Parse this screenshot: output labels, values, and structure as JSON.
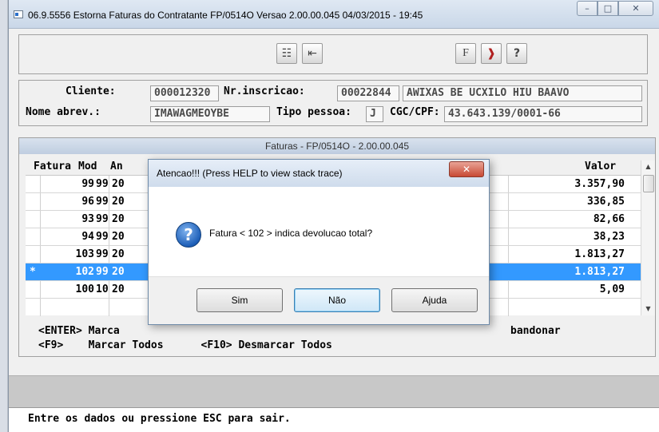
{
  "window": {
    "title": "06.9.5556  Estorna Faturas do Contratante FP/0514O Versao 2.00.00.045 04/03/2015 - 19:45",
    "buttons": {
      "minimize": "–",
      "maximize": "□",
      "close": "✕"
    }
  },
  "toolbar": {
    "icons": [
      "grid-star-icon",
      "exit-list-icon",
      "f-key-icon",
      "door-exit-icon",
      "help-question-icon"
    ],
    "glyphs": {
      "grid": "☷",
      "list": "⇤",
      "fkey": "F",
      "door": "❱",
      "help": "?"
    }
  },
  "client": {
    "cliente_label": "Cliente:",
    "cliente_value": "000012320",
    "inscricao_label": "Nr.inscricao:",
    "inscricao_value": "00022844",
    "name_value": "AWIXAS BE UCXILO HIU BAAVO",
    "nome_abrev_label": "Nome abrev.:",
    "nome_abrev_value": "IMAWAGMEOYBE",
    "tipo_pessoa_label": "Tipo pessoa:",
    "tipo_pessoa_value": "J",
    "cgc_label": "CGC/CPF:",
    "cgc_value": "43.643.139/0001-66"
  },
  "faturas": {
    "panel_title": "Faturas - FP/0514O - 2.00.00.045",
    "columns": {
      "fatura": "Fatura",
      "mod": "Mod",
      "an": "An",
      "valor": "Valor"
    },
    "rows": [
      {
        "mark": "",
        "fatura": "99",
        "mod": "99",
        "ano": "20",
        "valor": "3.357,90",
        "selected": false
      },
      {
        "mark": "",
        "fatura": "96",
        "mod": "99",
        "ano": "20",
        "valor": "336,85",
        "selected": false
      },
      {
        "mark": "",
        "fatura": "93",
        "mod": "99",
        "ano": "20",
        "valor": "82,66",
        "selected": false
      },
      {
        "mark": "",
        "fatura": "94",
        "mod": "99",
        "ano": "20",
        "valor": "38,23",
        "selected": false
      },
      {
        "mark": "",
        "fatura": "103",
        "mod": "99",
        "ano": "20",
        "valor": "1.813,27",
        "selected": false
      },
      {
        "mark": "*",
        "fatura": "102",
        "mod": "99",
        "ano": "20",
        "valor": "1.813,27",
        "selected": true
      },
      {
        "mark": "",
        "fatura": "100",
        "mod": "10",
        "ano": "20",
        "valor": "5,09",
        "selected": false
      }
    ],
    "help_line1_left": "<ENTER> Marca",
    "help_line1_right": "bandonar",
    "help_line2": "<F9>    Marcar Todos      <F10> Desmarcar Todos"
  },
  "status": {
    "message": "Entre os dados ou pressione ESC para sair."
  },
  "dialog": {
    "title": "Atencao!!! (Press HELP to view stack trace)",
    "close_glyph": "✕",
    "icon_glyph": "?",
    "message": "Fatura < 102 > indica devolucao total?",
    "buttons": {
      "yes": "Sim",
      "no": "Não",
      "help": "Ajuda"
    }
  }
}
